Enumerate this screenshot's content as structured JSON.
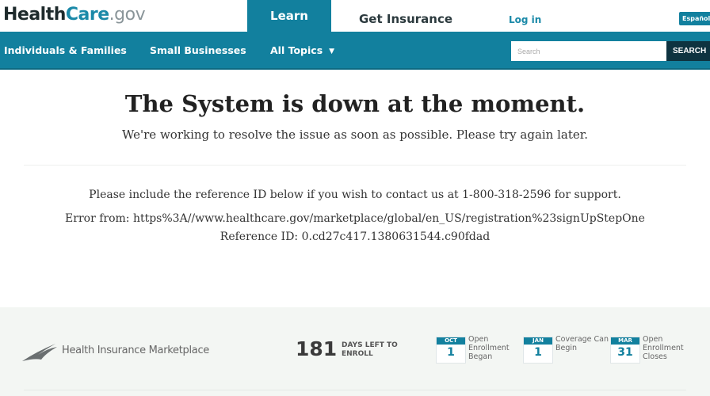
{
  "header": {
    "logo": {
      "part1": "Health",
      "part2": "Care",
      "part3": ".gov"
    },
    "tabs": [
      {
        "label": "Learn",
        "active": true
      },
      {
        "label": "Get Insurance",
        "active": false
      }
    ],
    "login_label": "Log in",
    "language_label": "Español"
  },
  "nav": {
    "items": [
      {
        "label": "Individuals & Families"
      },
      {
        "label": "Small Businesses"
      },
      {
        "label": "All Topics"
      }
    ],
    "search": {
      "placeholder": "Search",
      "value": "",
      "button_label": "SEARCH"
    }
  },
  "main": {
    "headline": "The System is down at the moment.",
    "subline": "We're working to resolve the issue as soon as possible. Please try again later.",
    "support_text": "Please include the reference ID below if you wish to contact us at 1-800-318-2596 for support.",
    "error_from": "Error from: https%3A//www.healthcare.gov/marketplace/global/en_US/registration%23signUpStepOne",
    "reference_id": "Reference ID: 0.cd27c417.1380631544.c90fdad"
  },
  "footer": {
    "marketplace_label": "Health Insurance Marketplace",
    "days_left": "181",
    "days_label": "DAYS LEFT TO ENROLL",
    "calendar": [
      {
        "month": "OCT",
        "day": "1",
        "label": "Open Enrollment Began"
      },
      {
        "month": "JAN",
        "day": "1",
        "label": "Coverage Can Begin"
      },
      {
        "month": "MAR",
        "day": "31",
        "label": "Open Enrollment Closes"
      }
    ]
  },
  "colors": {
    "brand": "#12809e",
    "search_button": "#0e3340"
  }
}
